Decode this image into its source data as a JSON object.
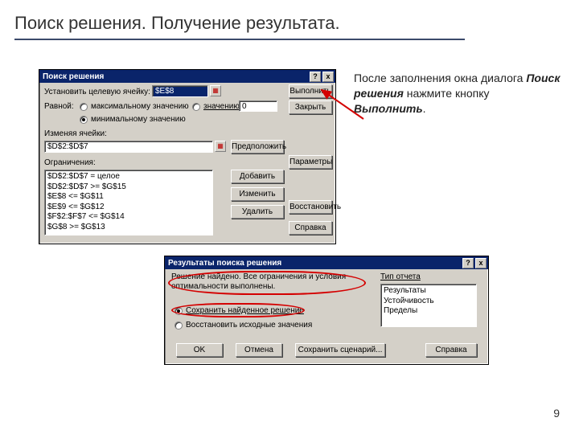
{
  "title": "Поиск решения. Получение результата.",
  "page_number": "9",
  "caption": {
    "part1": "После заполнения окна диалога ",
    "em1": "Поиск решения",
    "part2": " нажмите кнопку ",
    "em2": "Выполнить",
    "part3": "."
  },
  "dlg1": {
    "title": "Поиск решения",
    "help_q": "?",
    "close_x": "x",
    "target_label": "Установить целевую ячейку:",
    "target_value": "$E$8",
    "equal_label": "Равной:",
    "r_max": "максимальному значению",
    "r_val": "значению:",
    "r_val_value": "0",
    "r_min": "минимальному значению",
    "changing_label": "Изменяя ячейки:",
    "changing_value": "$D$2:$D$7",
    "constraints_label": "Ограничения:",
    "constraints": [
      "$D$2:$D$7 = целое",
      "$D$2:$D$7 >= $G$15",
      "$E$8 <= $G$11",
      "$E$9 <= $G$12",
      "$F$2:$F$7 <= $G$14",
      "$G$8 >= $G$13"
    ],
    "btn_execute": "Выполнить",
    "btn_close": "Закрыть",
    "btn_guess": "Предположить",
    "btn_params": "Параметры",
    "btn_add": "Добавить",
    "btn_change": "Изменить",
    "btn_delete": "Удалить",
    "btn_reset": "Восстановить",
    "btn_help": "Справка"
  },
  "dlg2": {
    "title": "Результаты поиска решения",
    "help_q": "?",
    "close_x": "x",
    "msg_line1": "Решение найдено. Все ограничения и условия",
    "msg_line2": "оптимальности выполнены.",
    "report_label": "Тип отчета",
    "reports": [
      "Результаты",
      "Устойчивость",
      "Пределы"
    ],
    "r_keep": "Сохранить найденное решение",
    "r_restore": "Восстановить исходные значения",
    "btn_ok": "OK",
    "btn_cancel": "Отмена",
    "btn_scenario": "Сохранить сценарий...",
    "btn_help": "Справка"
  }
}
